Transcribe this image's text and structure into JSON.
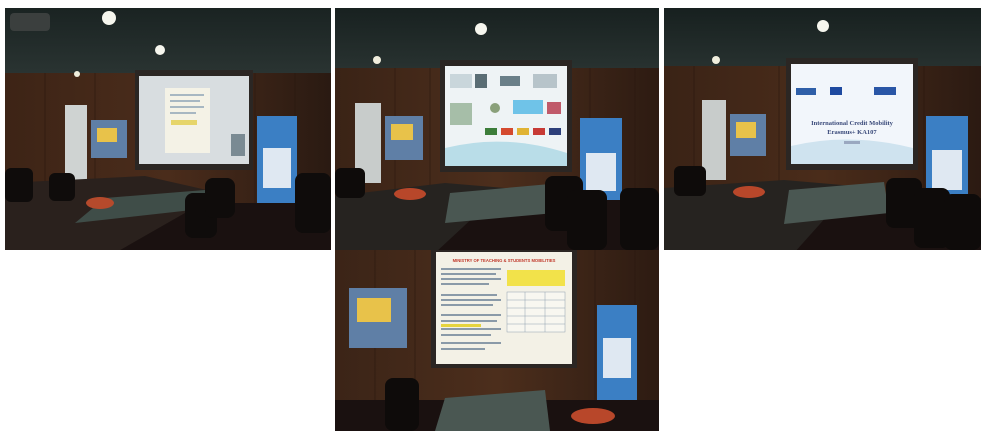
{
  "page": {
    "background": "#ffffff",
    "layout": "collage",
    "photo_count": 4
  },
  "photos": [
    {
      "name": "conference-room-photo-1",
      "screen_content": "document viewer with webcam thumbnail",
      "colors": {
        "wall": "#3a2418",
        "ceiling": "#1e2423",
        "screen": "#d8dde0",
        "banner": "#3b7fc4"
      }
    },
    {
      "name": "conference-room-photo-2",
      "screen_content": "slide with partner university logos and flags",
      "colors": {
        "wall": "#3a2418",
        "ceiling": "#1e2423",
        "screen": "#eef3f5",
        "banner": "#3b7fc4"
      }
    },
    {
      "name": "conference-room-photo-3",
      "screen_content": "title slide",
      "colors": {
        "wall": "#3a2418",
        "ceiling": "#1e2423",
        "screen": "#f2f6fb",
        "banner": "#3b7fc4"
      }
    },
    {
      "name": "conference-room-photo-4",
      "screen_content": "document slide with yellow header and table",
      "colors": {
        "wall": "#3a2418",
        "ceiling": "#1e2423",
        "screen": "#f3f1e6",
        "banner": "#3b7fc4"
      }
    }
  ],
  "slides": {
    "photo3_title": "International Credit Mobility\nErasmus+ KA107",
    "photo3_title_line1": "International Credit Mobility",
    "photo3_title_line2": "Erasmus+ KA107",
    "photo4_header": "MINISTRY OF TEACHING & STUDENTS MOBILITIES"
  }
}
